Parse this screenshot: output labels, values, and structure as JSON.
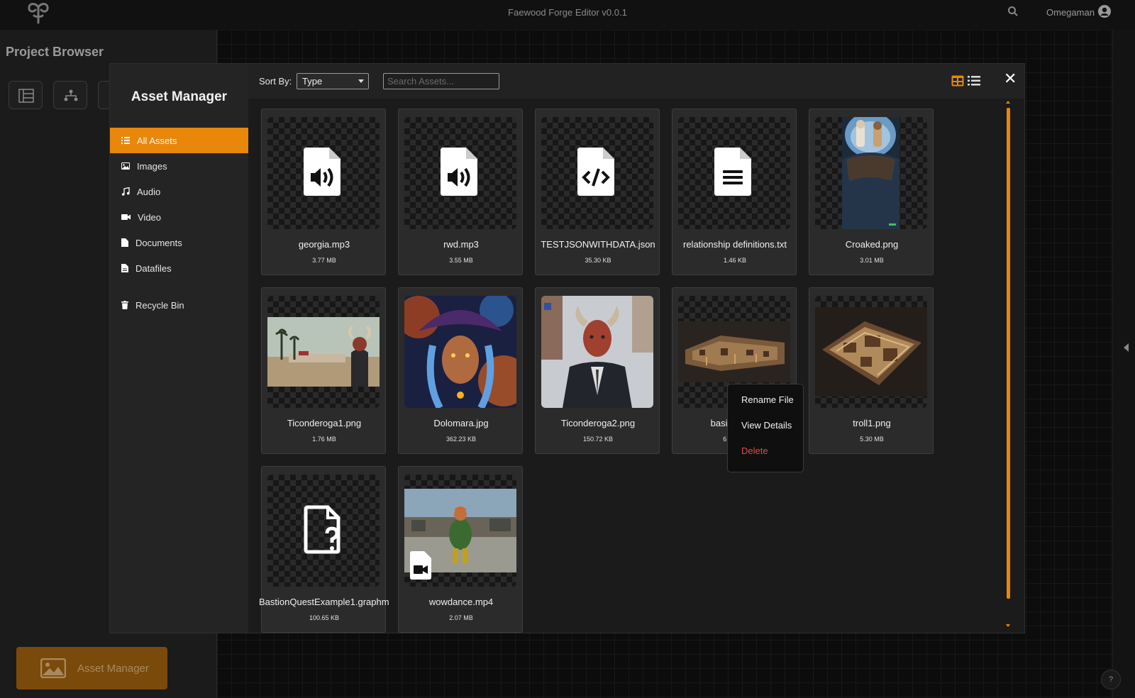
{
  "app": {
    "title": "Faewood Forge Editor v0.0.1",
    "user": "Omegaman"
  },
  "project_browser": {
    "title": "Project Browser",
    "launch_label": "Asset Manager"
  },
  "asset_manager": {
    "title": "Asset Manager",
    "nav": [
      {
        "label": "All Assets",
        "icon": "list-icon",
        "active": true
      },
      {
        "label": "Images",
        "icon": "image-icon"
      },
      {
        "label": "Audio",
        "icon": "music-icon"
      },
      {
        "label": "Video",
        "icon": "video-icon"
      },
      {
        "label": "Documents",
        "icon": "document-icon"
      },
      {
        "label": "Datafiles",
        "icon": "datafile-icon"
      },
      {
        "label": "Recycle Bin",
        "icon": "trash-icon"
      }
    ],
    "sort_label": "Sort By:",
    "sort_value": "Type",
    "search_placeholder": "Search Assets...",
    "accent_color": "#e8870a"
  },
  "assets": [
    {
      "name": "georgia.mp3",
      "size": "3.77 MB",
      "kind": "audio"
    },
    {
      "name": "rwd.mp3",
      "size": "3.55 MB",
      "kind": "audio"
    },
    {
      "name": "TESTJSONWITHDATA.json",
      "size": "35.30 KB",
      "kind": "code"
    },
    {
      "name": "relationship definitions.txt",
      "size": "1.46 KB",
      "kind": "text"
    },
    {
      "name": "Croaked.png",
      "size": "3.01 MB",
      "kind": "image"
    },
    {
      "name": "Ticonderoga1.png",
      "size": "1.76 MB",
      "kind": "image"
    },
    {
      "name": "Dolomara.jpg",
      "size": "362.23 KB",
      "kind": "image"
    },
    {
      "name": "Ticonderoga2.png",
      "size": "150.72 KB",
      "kind": "image"
    },
    {
      "name": "basilica.png",
      "size": "6.95 MB",
      "kind": "image"
    },
    {
      "name": "troll1.png",
      "size": "5.30 MB",
      "kind": "image"
    },
    {
      "name": "BastionQuestExample1.graphml",
      "size": "100.65 KB",
      "kind": "unknown"
    },
    {
      "name": "wowdance.mp4",
      "size": "2.07 MB",
      "kind": "video"
    }
  ],
  "context_menu": {
    "items": [
      "Rename File",
      "View Details",
      "Delete"
    ]
  }
}
